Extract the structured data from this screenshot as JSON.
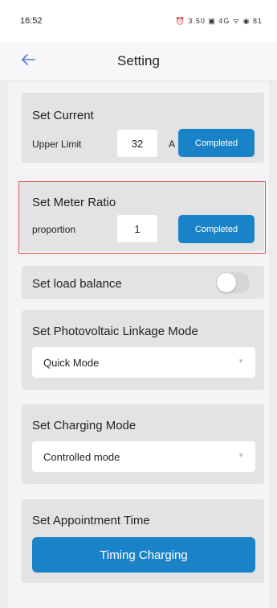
{
  "status_bar": {
    "time": "16:52",
    "icons": "⏰ 3.50 ▣ 4G ᯤ ◉ 81"
  },
  "header": {
    "back_icon": "arrow-left-icon",
    "title": "Setting"
  },
  "set_current": {
    "title": "Set Current",
    "label": "Upper Limit",
    "value": "32",
    "unit": "A",
    "button": "Completed"
  },
  "set_meter_ratio": {
    "title": "Set Meter Ratio",
    "label": "proportion",
    "value": "1",
    "button": "Completed"
  },
  "load_balance": {
    "title": "Set load balance",
    "enabled": false
  },
  "pv_linkage": {
    "title": "Set Photovoltaic Linkage Mode",
    "selected": "Quick Mode"
  },
  "charging_mode": {
    "title": "Set Charging Mode",
    "selected": "Controlled mode"
  },
  "appointment": {
    "title": "Set Appointment Time",
    "button": "Timing Charging"
  },
  "colors": {
    "accent": "#1a83c8",
    "highlight_border": "#e0574e",
    "card_bg": "#e3e3e6"
  }
}
